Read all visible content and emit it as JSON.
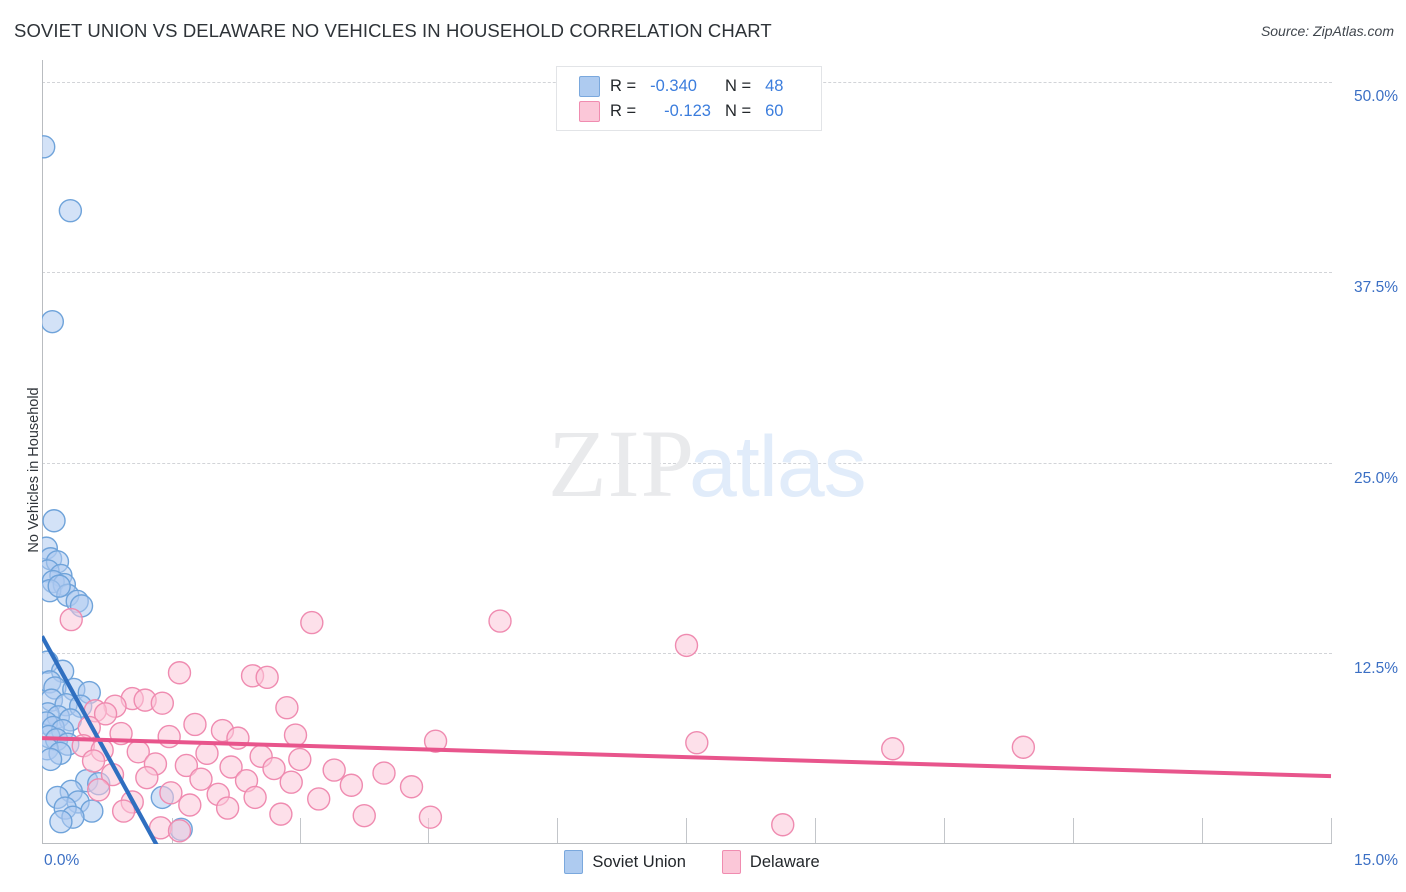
{
  "header": {
    "title": "SOVIET UNION VS DELAWARE NO VEHICLES IN HOUSEHOLD CORRELATION CHART",
    "source": "Source: ZipAtlas.com"
  },
  "watermark": {
    "part1": "ZIP",
    "part2": "atlas"
  },
  "stats": {
    "series1": {
      "r_label": "R =",
      "r_value": "-0.340",
      "n_label": "N =",
      "n_value": "48"
    },
    "series2": {
      "r_label": "R =",
      "r_value": "-0.123",
      "n_label": "N =",
      "n_value": "60"
    }
  },
  "legend": {
    "items": [
      {
        "label": "Soviet Union",
        "color": "#aecbf0"
      },
      {
        "label": "Delaware",
        "color": "#fbc7d8"
      }
    ]
  },
  "axes": {
    "ylabel": "No Vehicles in Household",
    "yticks": [
      "50.0%",
      "37.5%",
      "25.0%",
      "12.5%"
    ],
    "xtick_min": "0.0%",
    "xtick_max": "15.0%"
  },
  "chart_data": {
    "type": "scatter",
    "title": "SOVIET UNION VS DELAWARE NO VEHICLES IN HOUSEHOLD CORRELATION CHART",
    "xlabel": "",
    "ylabel": "No Vehicles in Household",
    "xlim": [
      0.0,
      15.0
    ],
    "ylim": [
      0.0,
      53.0
    ],
    "xtick_values": [
      0.0,
      15.0
    ],
    "ytick_values": [
      12.5,
      25.0,
      37.5,
      50.0
    ],
    "grid": "horizontal-dashed",
    "legend_position": "bottom-center",
    "series": [
      {
        "name": "Soviet Union",
        "color": "#aecbf0",
        "edge_color": "#6fa3da",
        "r": -0.34,
        "n": 48,
        "trendline": {
          "x0": 0.0,
          "y0": 13.6,
          "x1": 1.38,
          "y1": -0.6,
          "color": "#2f6fc0"
        },
        "points": [
          [
            0.02,
            45.8
          ],
          [
            0.33,
            41.6
          ],
          [
            0.12,
            34.3
          ],
          [
            0.14,
            21.2
          ],
          [
            0.05,
            19.4
          ],
          [
            0.1,
            18.7
          ],
          [
            0.18,
            18.5
          ],
          [
            0.07,
            17.9
          ],
          [
            0.22,
            17.6
          ],
          [
            0.13,
            17.2
          ],
          [
            0.26,
            17.0
          ],
          [
            0.09,
            16.6
          ],
          [
            0.3,
            16.3
          ],
          [
            0.41,
            15.9
          ],
          [
            0.46,
            15.6
          ],
          [
            0.2,
            16.9
          ],
          [
            0.06,
            11.9
          ],
          [
            0.24,
            11.3
          ],
          [
            0.09,
            10.6
          ],
          [
            0.15,
            10.2
          ],
          [
            0.37,
            10.1
          ],
          [
            0.55,
            9.9
          ],
          [
            0.11,
            9.4
          ],
          [
            0.28,
            9.1
          ],
          [
            0.45,
            9.0
          ],
          [
            0.07,
            8.5
          ],
          [
            0.19,
            8.3
          ],
          [
            0.33,
            8.1
          ],
          [
            0.05,
            7.9
          ],
          [
            0.13,
            7.6
          ],
          [
            0.24,
            7.4
          ],
          [
            0.08,
            7.0
          ],
          [
            0.17,
            6.8
          ],
          [
            0.3,
            6.5
          ],
          [
            0.06,
            6.2
          ],
          [
            0.21,
            5.9
          ],
          [
            0.1,
            5.5
          ],
          [
            0.52,
            4.1
          ],
          [
            0.66,
            3.9
          ],
          [
            0.34,
            3.4
          ],
          [
            0.18,
            3.0
          ],
          [
            0.42,
            2.7
          ],
          [
            0.27,
            2.3
          ],
          [
            0.58,
            2.1
          ],
          [
            0.36,
            1.7
          ],
          [
            0.22,
            1.4
          ],
          [
            1.4,
            3.0
          ],
          [
            1.62,
            0.9
          ]
        ]
      },
      {
        "name": "Delaware",
        "color": "#fbc7d8",
        "edge_color": "#ef8bb0",
        "r": -0.123,
        "n": 60,
        "trendline": {
          "x0": 0.0,
          "y0": 6.9,
          "x1": 15.0,
          "y1": 4.4,
          "color": "#e8558c"
        },
        "points": [
          [
            0.34,
            14.7
          ],
          [
            3.14,
            14.5
          ],
          [
            5.33,
            14.6
          ],
          [
            7.5,
            13.0
          ],
          [
            1.6,
            11.2
          ],
          [
            2.45,
            11.0
          ],
          [
            2.62,
            10.9
          ],
          [
            1.05,
            9.5
          ],
          [
            1.2,
            9.4
          ],
          [
            1.4,
            9.2
          ],
          [
            0.85,
            9.0
          ],
          [
            2.85,
            8.9
          ],
          [
            0.62,
            8.7
          ],
          [
            0.74,
            8.5
          ],
          [
            1.78,
            7.8
          ],
          [
            2.1,
            7.4
          ],
          [
            0.55,
            7.6
          ],
          [
            0.92,
            7.2
          ],
          [
            1.48,
            7.0
          ],
          [
            2.28,
            6.9
          ],
          [
            2.95,
            7.1
          ],
          [
            4.58,
            6.7
          ],
          [
            7.62,
            6.6
          ],
          [
            9.9,
            6.2
          ],
          [
            11.42,
            6.3
          ],
          [
            0.48,
            6.4
          ],
          [
            0.7,
            6.1
          ],
          [
            1.12,
            6.0
          ],
          [
            1.92,
            5.9
          ],
          [
            2.55,
            5.7
          ],
          [
            3.0,
            5.5
          ],
          [
            0.6,
            5.4
          ],
          [
            1.32,
            5.2
          ],
          [
            1.68,
            5.1
          ],
          [
            2.2,
            5.0
          ],
          [
            2.7,
            4.9
          ],
          [
            3.4,
            4.8
          ],
          [
            3.98,
            4.6
          ],
          [
            0.82,
            4.5
          ],
          [
            1.22,
            4.3
          ],
          [
            1.85,
            4.2
          ],
          [
            2.38,
            4.1
          ],
          [
            2.9,
            4.0
          ],
          [
            3.6,
            3.8
          ],
          [
            4.3,
            3.7
          ],
          [
            0.66,
            3.5
          ],
          [
            1.5,
            3.3
          ],
          [
            2.05,
            3.2
          ],
          [
            2.48,
            3.0
          ],
          [
            3.22,
            2.9
          ],
          [
            1.05,
            2.7
          ],
          [
            1.72,
            2.5
          ],
          [
            2.16,
            2.3
          ],
          [
            0.95,
            2.1
          ],
          [
            2.78,
            1.9
          ],
          [
            3.75,
            1.8
          ],
          [
            4.52,
            1.7
          ],
          [
            8.62,
            1.2
          ],
          [
            1.38,
            1.0
          ],
          [
            1.6,
            0.8
          ]
        ]
      }
    ]
  }
}
